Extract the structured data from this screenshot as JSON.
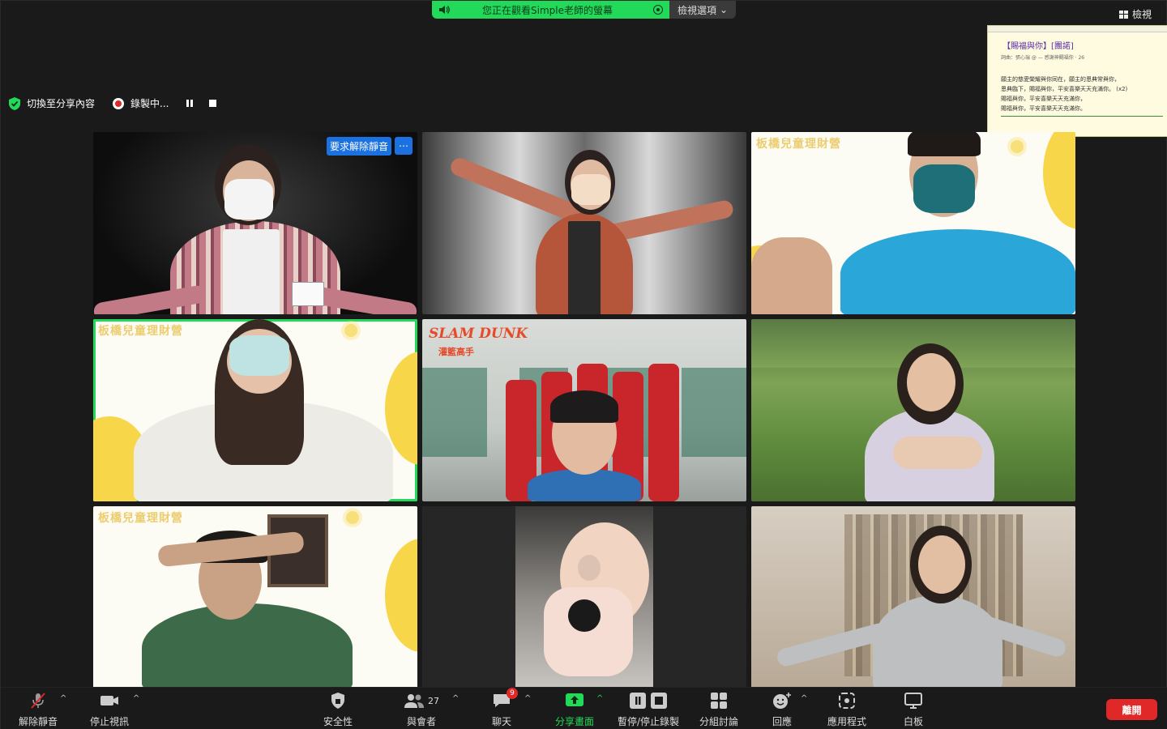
{
  "banner": {
    "viewing_text": "您正在觀看Simple老師的螢幕",
    "view_options_label": "檢視選項"
  },
  "view_button_label": "檢視",
  "lyric_panel": {
    "title": "【賜福與你】[團諾]",
    "subtitle": "詞曲：張心瑞 @ — 感謝神賜福你 · 26",
    "lines": [
      "願主的慈愛榮耀與你同在，願主的恩典常與你，",
      "恩典臨下，賜福與你，平安喜樂天天充滿你。 (x2)",
      "賜福與你，平安喜樂天天充滿你，",
      "賜福與你，平安喜樂天天充滿你。"
    ]
  },
  "status": {
    "switch_label": "切換至分享內容",
    "recording_label": "錄製中..."
  },
  "tiles": [
    {
      "name": "participant-1",
      "overlay_request": "要求解除靜音",
      "overlay_more": "⋯"
    },
    {
      "name": "participant-2"
    },
    {
      "name": "participant-3",
      "bg_title": "板橋兒童理財營"
    },
    {
      "name": "participant-4",
      "bg_title": "板橋兒童理財營",
      "active": true
    },
    {
      "name": "participant-5",
      "bg_title": "SLAM DUNK",
      "bg_subtitle": "灌籃高手"
    },
    {
      "name": "participant-6"
    },
    {
      "name": "participant-7",
      "bg_title": "板橋兒童理財營"
    },
    {
      "name": "participant-8"
    },
    {
      "name": "participant-9"
    }
  ],
  "toolbar": {
    "unmute": "解除靜音",
    "stop_video": "停止視訊",
    "security": "安全性",
    "participants": "與會者",
    "participants_count": "27",
    "chat": "聊天",
    "chat_badge": "9",
    "share": "分享畫面",
    "pause_record": "暫停/停止錄製",
    "breakout": "分組討論",
    "reactions": "回應",
    "apps": "應用程式",
    "whiteboard": "白板",
    "leave": "離開"
  },
  "colors": {
    "accent_green": "#23d959",
    "blue": "#1b71e0",
    "red": "#e02828"
  }
}
